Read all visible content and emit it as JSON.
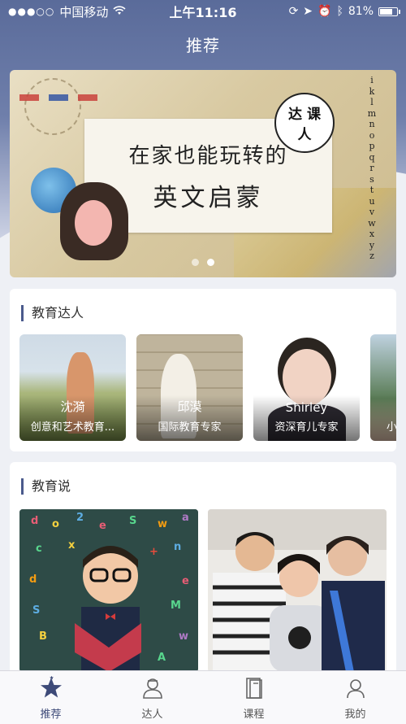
{
  "status_bar": {
    "carrier": "中国移动",
    "time": "上午11:16",
    "battery_pct": "81%",
    "battery_level": 0.81
  },
  "header": {
    "title": "推荐"
  },
  "banner": {
    "line1": "在家也能玩转的",
    "line2": "英文启蒙",
    "badge_top": "达 课",
    "badge_bottom": "人",
    "letters": [
      "i",
      "k",
      "l",
      "m",
      "n",
      "o",
      "p",
      "q",
      "r",
      "s",
      "t",
      "u",
      "v",
      "w",
      "x",
      "y",
      "z"
    ],
    "page_count": 2,
    "active_page": 2
  },
  "experts_section": {
    "title": "教育达人",
    "items": [
      {
        "name": "沈漪",
        "title": "创意和艺术教育..."
      },
      {
        "name": "邱漠",
        "title": "国际教育专家"
      },
      {
        "name": "Shirley",
        "title": "资深育儿专家"
      },
      {
        "name": "",
        "title": "小"
      }
    ]
  },
  "talks_section": {
    "title": "教育说"
  },
  "tabbar": {
    "items": [
      {
        "label": "推荐",
        "icon": "star-icon",
        "active": true
      },
      {
        "label": "达人",
        "icon": "person-icon",
        "active": false
      },
      {
        "label": "课程",
        "icon": "book-icon",
        "active": false
      },
      {
        "label": "我的",
        "icon": "profile-icon",
        "active": false
      }
    ]
  },
  "colors": {
    "accent": "#3d4a78",
    "header_bg": "#5a6b9a"
  }
}
